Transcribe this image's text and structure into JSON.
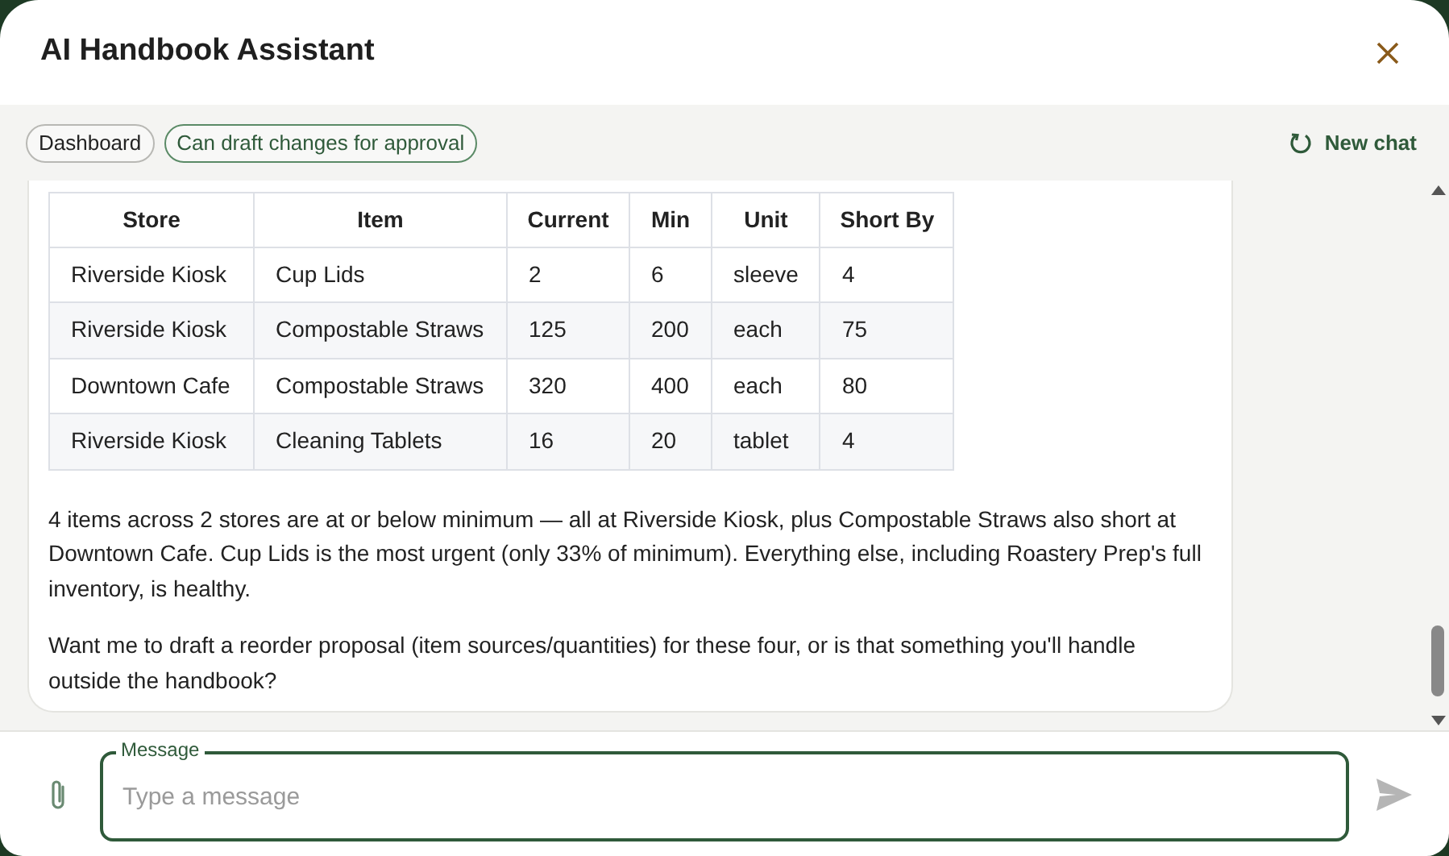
{
  "dialog": {
    "title": "AI Handbook Assistant"
  },
  "toolbar": {
    "chips": [
      {
        "label": "Dashboard",
        "kind": "plain"
      },
      {
        "label": "Can draft changes for approval",
        "kind": "accent"
      }
    ],
    "new_chat": "New chat"
  },
  "message": {
    "table": {
      "columns": [
        "Store",
        "Item",
        "Current",
        "Min",
        "Unit",
        "Short By"
      ],
      "rows": [
        [
          "Riverside Kiosk",
          "Cup Lids",
          "2",
          "6",
          "sleeve",
          "4"
        ],
        [
          "Riverside Kiosk",
          "Compostable Straws",
          "125",
          "200",
          "each",
          "75"
        ],
        [
          "Downtown Cafe",
          "Compostable Straws",
          "320",
          "400",
          "each",
          "80"
        ],
        [
          "Riverside Kiosk",
          "Cleaning Tablets",
          "16",
          "20",
          "tablet",
          "4"
        ]
      ]
    },
    "paragraphs": [
      "4 items across 2 stores are at or below minimum — all at Riverside Kiosk, plus Compostable Straws also short at Downtown Cafe. Cup Lids is the most urgent (only 33% of minimum). Everything else, including Roastery Prep's full inventory, is healthy.",
      "Want me to draft a reorder proposal (item sources/quantities) for these four, or is that something you'll handle outside the handbook?"
    ]
  },
  "composer": {
    "label": "Message",
    "placeholder": "Type a message"
  }
}
